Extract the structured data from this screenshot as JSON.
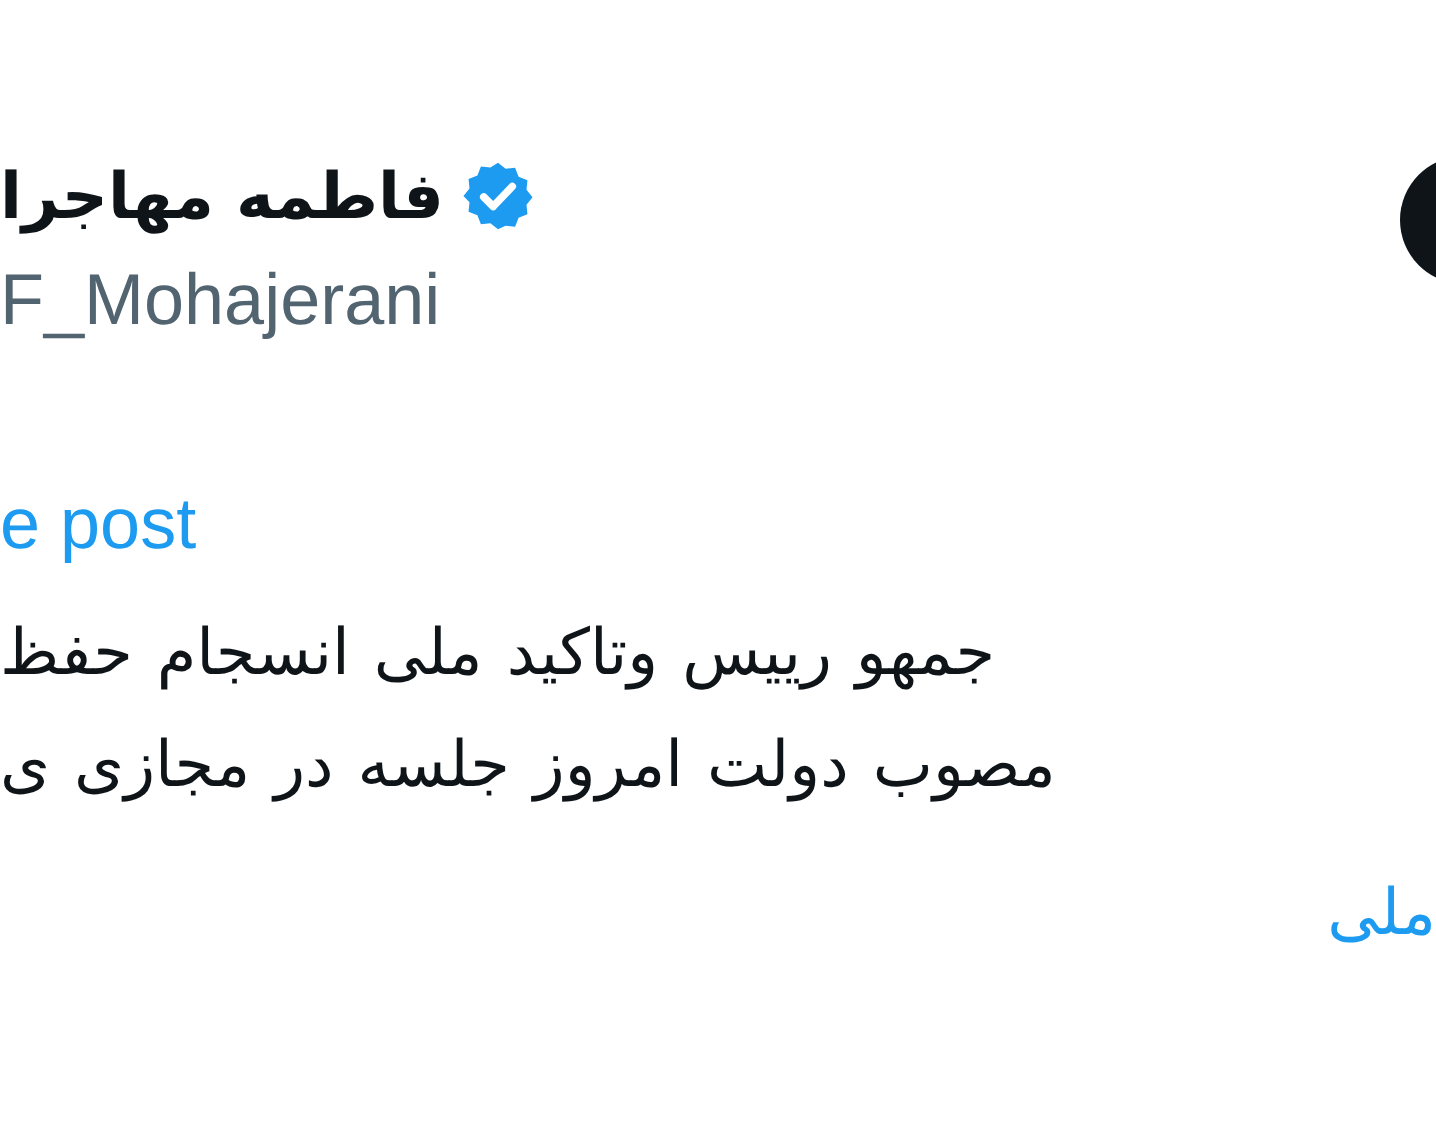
{
  "author": {
    "name": "فاطمه مهاجرا",
    "verified": true,
    "handle": "F_Mohajerani"
  },
  "translate_link": "e post",
  "body_lines": [
    "حفظ انسجام ملی وتاکید رییس جمهو",
    "ی مجازی در جلسه امروز دولت مصوب"
  ],
  "hashtag": "ملی"
}
